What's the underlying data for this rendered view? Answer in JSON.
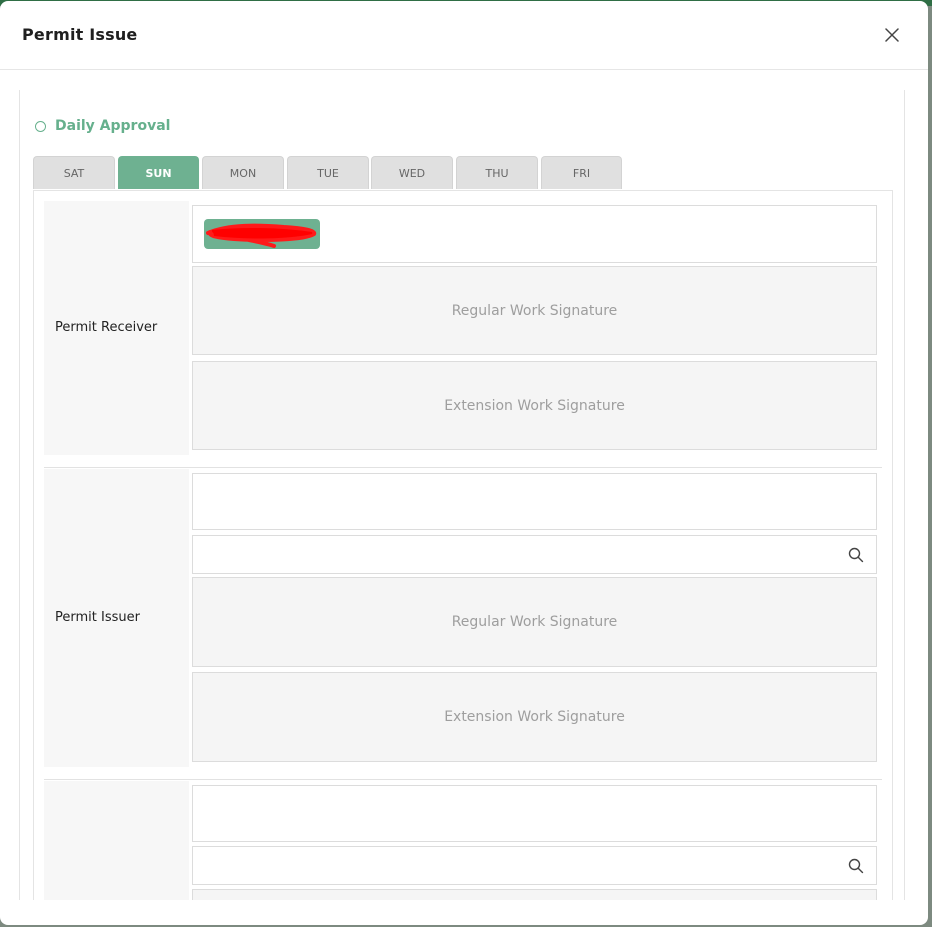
{
  "modal": {
    "title": "Permit Issue"
  },
  "section": {
    "title": "Daily Approval"
  },
  "tabs": [
    {
      "label": "SAT",
      "active": false
    },
    {
      "label": "SUN",
      "active": true
    },
    {
      "label": "MON",
      "active": false
    },
    {
      "label": "TUE",
      "active": false
    },
    {
      "label": "WED",
      "active": false
    },
    {
      "label": "THU",
      "active": false
    },
    {
      "label": "FRI",
      "active": false
    }
  ],
  "rows": {
    "receiver": {
      "label": "Permit Receiver",
      "regular_signature": "Regular Work Signature",
      "extension_signature": "Extension Work Signature"
    },
    "issuer": {
      "label": "Permit Issuer",
      "regular_signature": "Regular Work Signature",
      "extension_signature": "Extension Work Signature"
    },
    "third": {
      "label": ""
    }
  },
  "icons": {
    "close": "close-icon",
    "search": "search-icon",
    "radio": "radio-circle-icon"
  },
  "colors": {
    "accent": "#6eb191",
    "tab_inactive": "#e0e0e0",
    "signature_bg": "#f5f5f5",
    "redaction": "#ff0000"
  }
}
